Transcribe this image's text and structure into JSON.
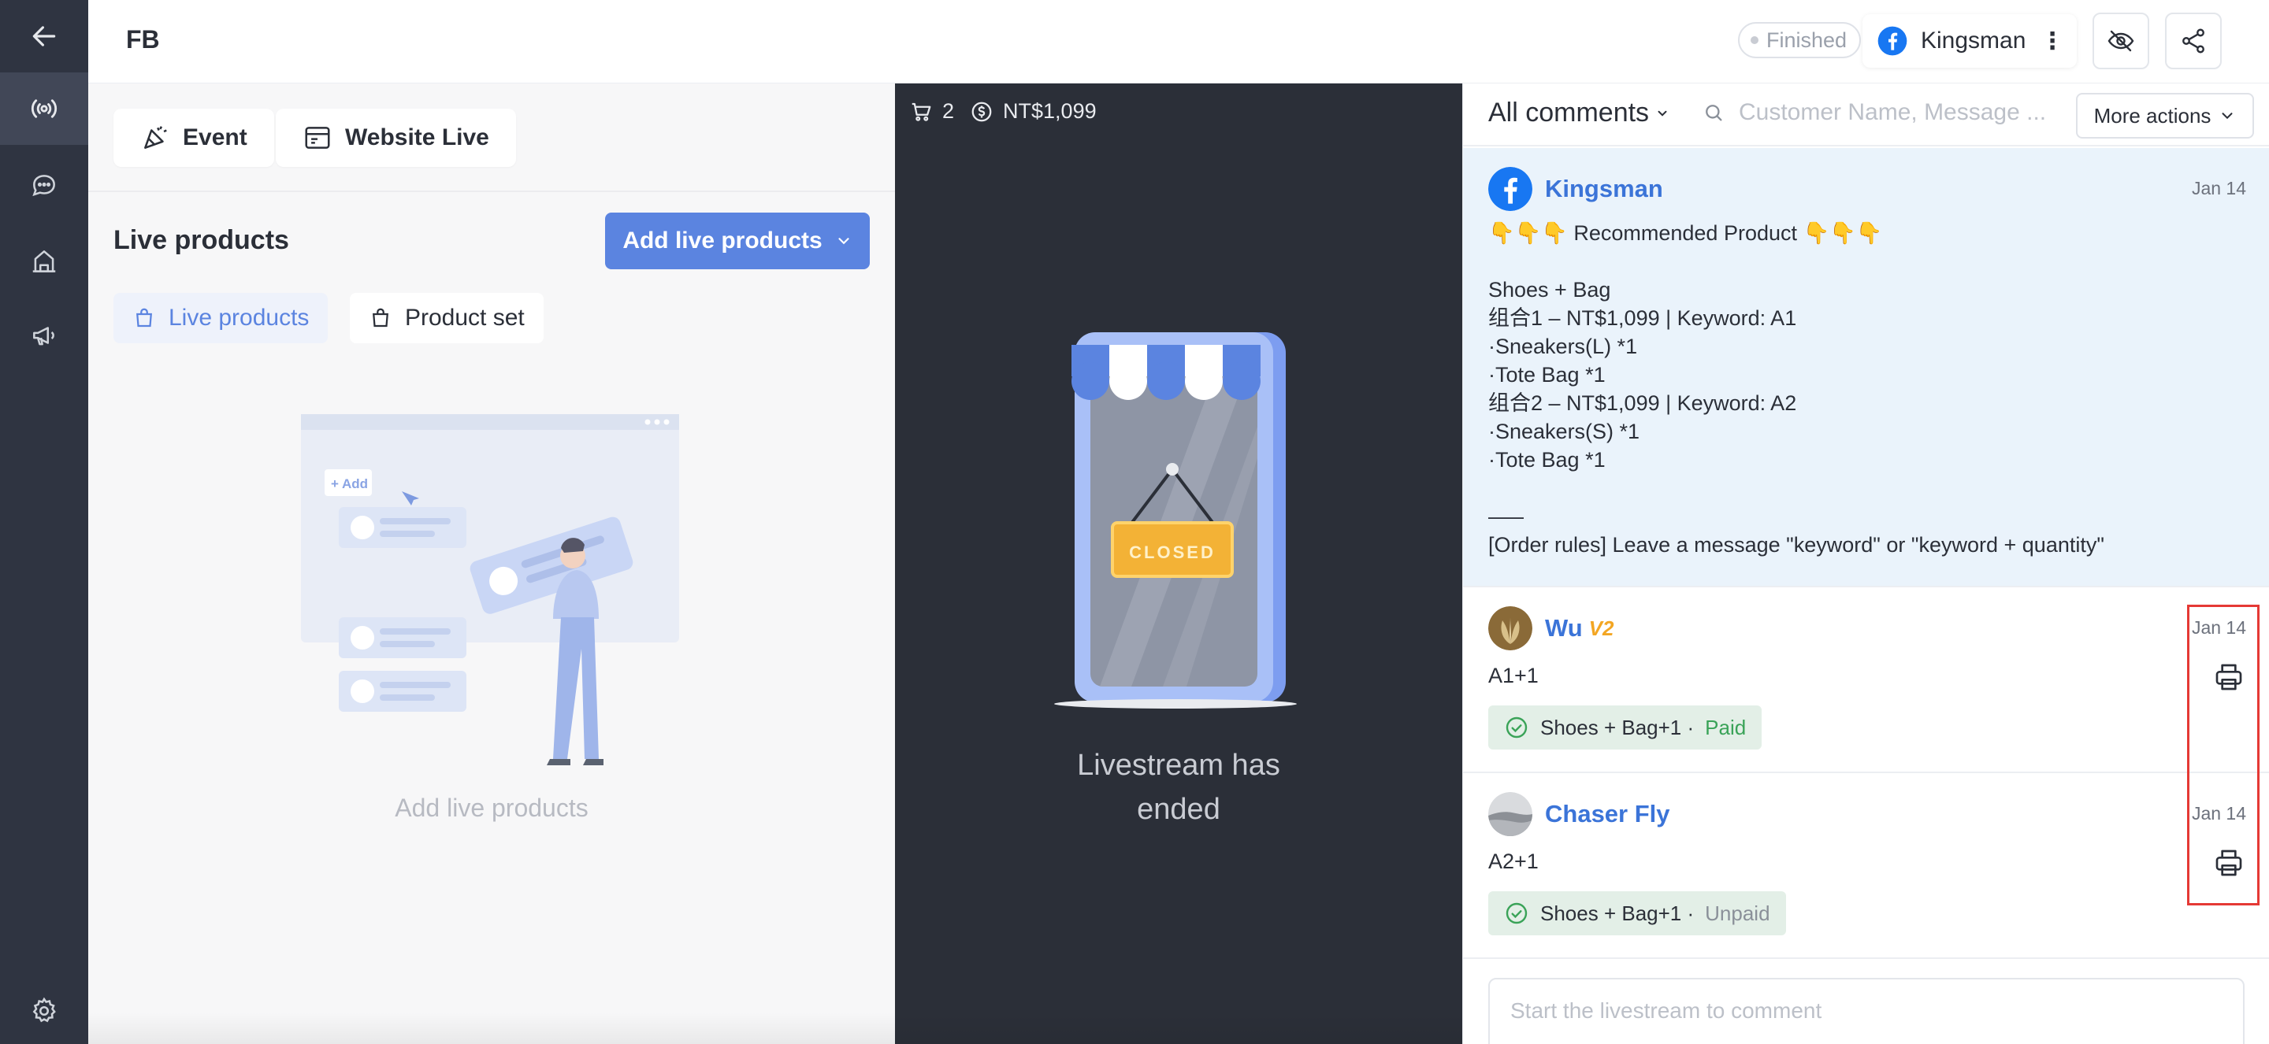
{
  "header": {
    "title": "FB",
    "status": "Finished",
    "account_name": "Kingsman"
  },
  "left": {
    "tabs": [
      {
        "label": "Event"
      },
      {
        "label": "Website Live"
      }
    ],
    "section_title": "Live products",
    "add_button_label": "Add live products",
    "sub_tabs": [
      {
        "label": "Live products",
        "active": true
      },
      {
        "label": "Product set",
        "active": false
      }
    ],
    "illustration_add_label": "+ Add",
    "empty_text": "Add live products"
  },
  "center": {
    "cart_count": "2",
    "amount": "NT$1,099",
    "closed_sign": "CLOSED",
    "message_line1": "Livestream has",
    "message_line2": "ended"
  },
  "comments": {
    "filter_label": "All comments",
    "search_placeholder": "Customer Name, Message ...",
    "more_actions_label": "More actions",
    "pinned": {
      "name": "Kingsman",
      "date": "Jan 14",
      "body": "👇👇👇 Recommended Product 👇👇👇\n\nShoes + Bag\n组合1 – NT$1,099 | Keyword: A1\n·Sneakers(L) *1\n·Tote Bag *1\n组合2 – NT$1,099 | Keyword: A2\n·Sneakers(S) *1\n·Tote Bag *1\n\n–––\n[Order rules] Leave a message \"keyword\" or \"keyword + quantity\""
    },
    "items": [
      {
        "name": "Wu",
        "badge": "V2",
        "date": "Jan 14",
        "text": "A1+1",
        "order": "Shoes + Bag+1 ·",
        "payment": "Paid"
      },
      {
        "name": "Chaser Fly",
        "date": "Jan 14",
        "text": "A2+1",
        "order": "Shoes + Bag+1 ·",
        "payment": "Unpaid"
      }
    ],
    "input_placeholder": "Start the livestream to comment"
  },
  "colors": {
    "rail": "#2f3441",
    "accent": "#5b84e0",
    "link": "#3b74d8",
    "paid": "#3aa358",
    "highlight_box": "#e53935"
  },
  "icons": [
    "back-arrow-icon",
    "broadcast-icon",
    "chat-icon",
    "shop-icon",
    "megaphone-icon",
    "settings-icon",
    "facebook-icon",
    "eye-off-icon",
    "share-icon",
    "cart-icon",
    "dollar-icon",
    "search-icon",
    "chevron-down-icon",
    "check-circle-icon",
    "printer-icon",
    "bag-icon"
  ]
}
